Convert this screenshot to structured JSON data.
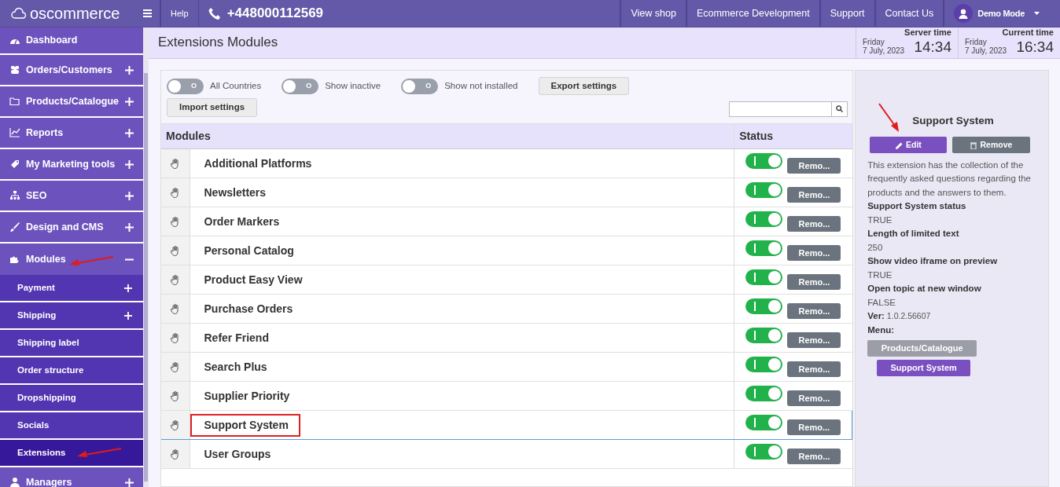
{
  "topbar": {
    "logo": "oscommerce",
    "help": "Help",
    "phone": "+448000112569",
    "links": [
      "View shop",
      "Ecommerce Development",
      "Support",
      "Contact Us"
    ],
    "user": "Demo Mode"
  },
  "sidebar": {
    "items": [
      {
        "label": "Dashboard",
        "expanded": false,
        "expandable": false,
        "annotated": false
      },
      {
        "label": "Orders/Customers",
        "expanded": false,
        "expandable": true,
        "annotated": false
      },
      {
        "label": "Products/Catalogue",
        "expanded": false,
        "expandable": true,
        "annotated": false
      },
      {
        "label": "Reports",
        "expanded": false,
        "expandable": true,
        "annotated": false
      },
      {
        "label": "My Marketing tools",
        "expanded": false,
        "expandable": true,
        "annotated": false
      },
      {
        "label": "SEO",
        "expanded": false,
        "expandable": true,
        "annotated": false
      },
      {
        "label": "Design and CMS",
        "expanded": false,
        "expandable": true,
        "annotated": false
      },
      {
        "label": "Modules",
        "expanded": true,
        "expandable": true,
        "annotated": true,
        "children": [
          {
            "label": "Payment",
            "expandable": true,
            "selected": false,
            "annotated": false
          },
          {
            "label": "Shipping",
            "expandable": true,
            "selected": false,
            "annotated": false
          },
          {
            "label": "Shipping label",
            "expandable": false,
            "selected": false,
            "annotated": false
          },
          {
            "label": "Order structure",
            "expandable": false,
            "selected": false,
            "annotated": false
          },
          {
            "label": "Dropshipping",
            "expandable": false,
            "selected": false,
            "annotated": false
          },
          {
            "label": "Socials",
            "expandable": false,
            "selected": false,
            "annotated": false
          },
          {
            "label": "Extensions",
            "expandable": false,
            "selected": true,
            "annotated": true
          }
        ]
      },
      {
        "label": "Managers",
        "expanded": false,
        "expandable": true,
        "annotated": false
      }
    ]
  },
  "header": {
    "title": "Extensions Modules",
    "clocks": [
      {
        "label": "Server time",
        "day": "Friday",
        "date": "7 July, 2023",
        "time": "14:34"
      },
      {
        "label": "Current time",
        "day": "Friday",
        "date": "7 July, 2023",
        "time": "16:34"
      }
    ]
  },
  "filters": [
    {
      "label": "All Countries",
      "on": false,
      "switch_text": "O"
    },
    {
      "label": "Show inactive",
      "on": false,
      "switch_text": "O"
    },
    {
      "label": "Show not installed",
      "on": false,
      "switch_text": "O"
    }
  ],
  "buttons": [
    "Export settings",
    "Import settings"
  ],
  "table": {
    "columns": [
      "Modules",
      "Status"
    ],
    "rows": [
      {
        "name": "Additional Platforms",
        "on": true,
        "action": "Remo...",
        "selected": false
      },
      {
        "name": "Newsletters",
        "on": true,
        "action": "Remo...",
        "selected": false
      },
      {
        "name": "Order Markers",
        "on": true,
        "action": "Remo...",
        "selected": false
      },
      {
        "name": "Personal Catalog",
        "on": true,
        "action": "Remo...",
        "selected": false
      },
      {
        "name": "Product Easy View",
        "on": true,
        "action": "Remo...",
        "selected": false
      },
      {
        "name": "Purchase Orders",
        "on": true,
        "action": "Remo...",
        "selected": false
      },
      {
        "name": "Refer Friend",
        "on": true,
        "action": "Remo...",
        "selected": false
      },
      {
        "name": "Search Plus",
        "on": true,
        "action": "Remo...",
        "selected": false
      },
      {
        "name": "Supplier Priority",
        "on": true,
        "action": "Remo...",
        "selected": false
      },
      {
        "name": "Support System",
        "on": true,
        "action": "Remo...",
        "selected": true
      },
      {
        "name": "User Groups",
        "on": true,
        "action": "Remo...",
        "selected": false
      }
    ]
  },
  "details": {
    "title": "Support System",
    "edit": "Edit",
    "remove": "Remove",
    "edit_annotated": true,
    "description": "This extension has the collection of the frequently asked questions regarding the products and the answers to them.",
    "fields": [
      {
        "label": "Support System status",
        "value": "TRUE"
      },
      {
        "label": "Length of limited text",
        "value": "250"
      },
      {
        "label": "Show video iframe on preview",
        "value": "TRUE"
      },
      {
        "label": "Open topic at new window",
        "value": "FALSE"
      }
    ],
    "version": "**Ver:** 1.0.2.56607",
    "menu_label": "Menu:",
    "menu": [
      {
        "label": "Products/Catalogue",
        "kind": "parent"
      },
      {
        "label": "Support System",
        "kind": "current"
      }
    ]
  }
}
